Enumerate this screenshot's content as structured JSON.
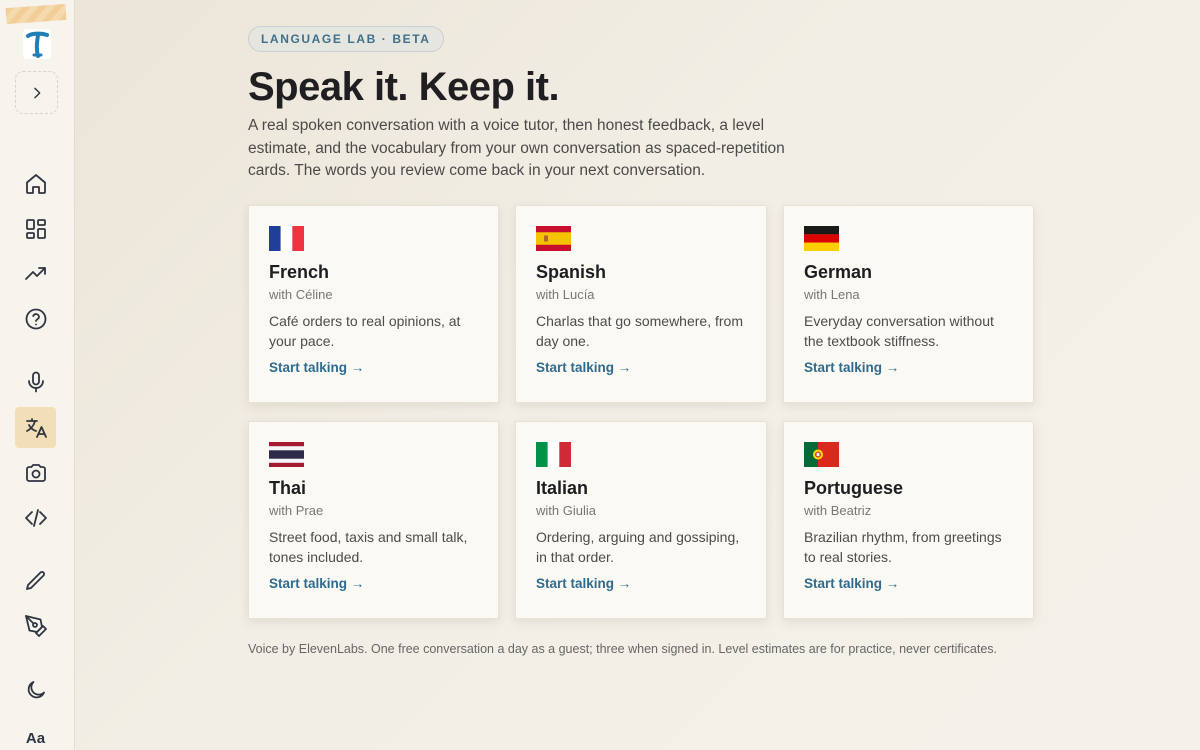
{
  "sidebar": {
    "icons": [
      "home-icon",
      "grid-icon",
      "trending-up-icon",
      "help-circle-icon",
      "mic-icon",
      "translate-icon",
      "camera-icon",
      "code-icon",
      "pencil-icon",
      "pen-tool-icon",
      "moon-icon"
    ],
    "active": "translate-icon",
    "font_button_label": "Aa"
  },
  "header": {
    "badge": "LANGUAGE LAB · BETA",
    "title": "Speak it. Keep it.",
    "intro": "A real spoken conversation with a voice tutor, then honest feedback, a level estimate, and the vocabulary from your own conversation as spaced-repetition cards. The words you review come back in your next conversation."
  },
  "cards": [
    {
      "language": "French",
      "tutor": "with Céline",
      "description": "Café orders to real opinions, at your pace.",
      "link": "Start talking →"
    },
    {
      "language": "Spanish",
      "tutor": "with Lucía",
      "description": "Charlas that go somewhere, from day one.",
      "link": "Start talking →"
    },
    {
      "language": "German",
      "tutor": "with Lena",
      "description": "Everyday conversation without the textbook stiffness.",
      "link": "Start talking →"
    },
    {
      "language": "Thai",
      "tutor": "with Prae",
      "description": "Street food, taxis and small talk, tones included.",
      "link": "Start talking →"
    },
    {
      "language": "Italian",
      "tutor": "with Giulia",
      "description": "Ordering, arguing and gossiping, in that order.",
      "link": "Start talking →"
    },
    {
      "language": "Portuguese",
      "tutor": "with Beatriz",
      "description": "Brazilian rhythm, from greetings to real stories.",
      "link": "Start talking →"
    }
  ],
  "footer": "Voice by ElevenLabs. One free conversation a day as a guest; three when signed in. Level estimates are for practice, never certificates.",
  "colors": {
    "accent_link": "#2f6b8e",
    "active_nav": "#f2dfb7",
    "badge_text": "#3f6f8a"
  }
}
